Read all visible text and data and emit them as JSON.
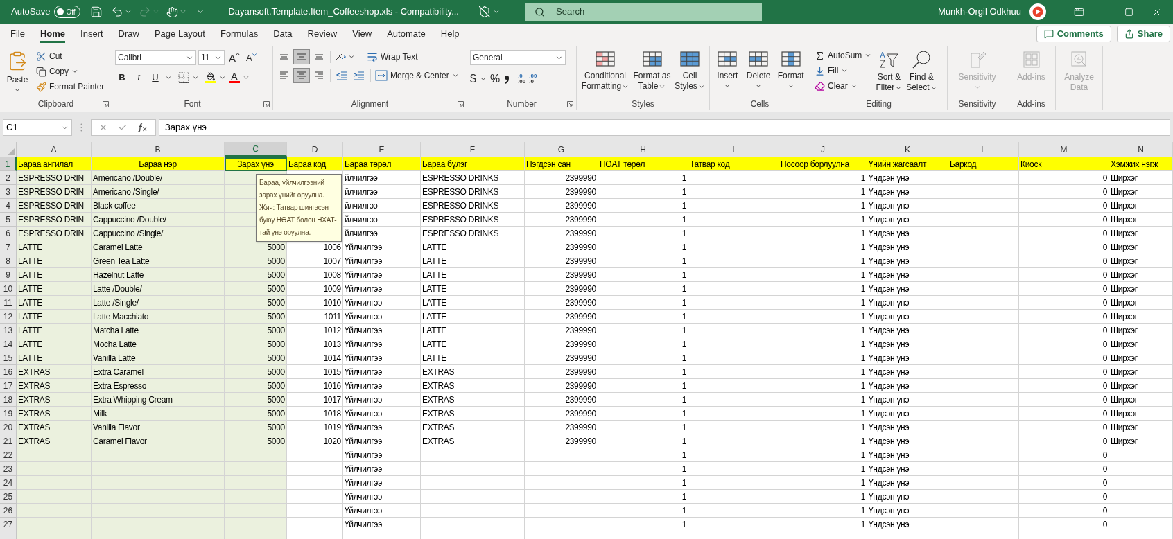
{
  "title_bar": {
    "autosave": {
      "label": "AutoSave",
      "state_text": "Off",
      "on": false
    },
    "redo_enabled": false,
    "file_name": "Dayansoft.Template.Item_Coffeeshop.xls - Compatibility...",
    "search": {
      "placeholder": "Search"
    },
    "user": "Munkh-Orgil Odkhuu"
  },
  "menu_tabs": [
    {
      "label": "File",
      "selected": false
    },
    {
      "label": "Home",
      "selected": true
    },
    {
      "label": "Insert",
      "selected": false
    },
    {
      "label": "Draw",
      "selected": false
    },
    {
      "label": "Page Layout",
      "selected": false
    },
    {
      "label": "Formulas",
      "selected": false
    },
    {
      "label": "Data",
      "selected": false
    },
    {
      "label": "Review",
      "selected": false
    },
    {
      "label": "View",
      "selected": false
    },
    {
      "label": "Automate",
      "selected": false
    },
    {
      "label": "Help",
      "selected": false
    }
  ],
  "actions": [
    {
      "label": "Comments"
    },
    {
      "label": "Share"
    }
  ],
  "ribbon": {
    "groups": [
      {
        "label": "Clipboard",
        "launcher": true,
        "disabled": false,
        "items": [
          {
            "lines": [
              "Paste"
            ]
          },
          {
            "lines": [
              "Cut"
            ]
          },
          {
            "lines": [
              "Copy"
            ]
          },
          {
            "lines": [
              "Format Painter"
            ]
          }
        ]
      },
      {
        "label": "Font",
        "launcher": true,
        "disabled": false,
        "font": "Calibri",
        "size": "11",
        "grow": "A",
        "shrink": "A",
        "bold": "B",
        "italic": "I",
        "underline": "U",
        "font_color": "A"
      },
      {
        "label": "Alignment",
        "launcher": true,
        "disabled": false,
        "vertical": [
          {
            "selected": false
          },
          {
            "selected": true
          },
          {
            "selected": false
          }
        ],
        "horizontal": [
          {
            "selected": false
          },
          {
            "selected": true
          },
          {
            "selected": false
          }
        ],
        "items": [
          {
            "lines": [
              "Wrap Text"
            ]
          },
          {
            "lines": [
              "Merge & Center"
            ]
          }
        ]
      },
      {
        "label": "Number",
        "launcher": true,
        "disabled": false,
        "format": "General",
        "currency": "$",
        "percent": "%",
        "increase_decimal": [
          ".0",
          ".00"
        ],
        "decrease_decimal": [
          ".00",
          ".0"
        ]
      },
      {
        "label": "Styles",
        "launcher": false,
        "disabled": false,
        "items": [
          {
            "lines": [
              "Conditional",
              "Formatting"
            ]
          },
          {
            "lines": [
              "Format as",
              "Table"
            ]
          },
          {
            "lines": [
              "Cell",
              "Styles"
            ]
          }
        ]
      },
      {
        "label": "Cells",
        "launcher": false,
        "disabled": false,
        "items": [
          {
            "lines": [
              "Insert"
            ]
          },
          {
            "lines": [
              "Delete"
            ]
          },
          {
            "lines": [
              "Format"
            ]
          }
        ]
      },
      {
        "label": "Editing",
        "launcher": false,
        "disabled": false,
        "items": [
          {
            "lines": [
              "AutoSum"
            ]
          },
          {
            "lines": [
              "Fill"
            ]
          },
          {
            "lines": [
              "Clear"
            ]
          },
          {
            "lines": [
              "Sort &",
              "Filter"
            ]
          },
          {
            "lines": [
              "Find &",
              "Select"
            ]
          }
        ]
      },
      {
        "label": "Sensitivity",
        "launcher": false,
        "disabled": true,
        "items": [
          {
            "lines": [
              "Sensitivity"
            ]
          }
        ]
      },
      {
        "label": "Add-ins",
        "launcher": false,
        "disabled": true,
        "items": [
          {
            "lines": [
              "Add-ins"
            ]
          }
        ]
      },
      {
        "launcher": false,
        "disabled": true,
        "items": [
          {
            "lines": [
              "Analyze",
              "Data"
            ]
          }
        ]
      }
    ]
  },
  "formula_bar": {
    "name_box": "C1",
    "formula": "Зарах үнэ"
  },
  "sheet": {
    "input_message": "Бараа, үйлчилгээний зарах үнийг оруулна. Жич: Татвар шингэсэн буюу НӨАТ болон НХАТ-тай үнэ оруулна.",
    "columns": [
      {
        "letter": "A",
        "numeric": false,
        "shaded": true,
        "centered": false,
        "selected": false
      },
      {
        "letter": "B",
        "numeric": false,
        "shaded": true,
        "centered": true,
        "selected": false
      },
      {
        "letter": "C",
        "numeric": true,
        "shaded": true,
        "centered": true,
        "selected": true
      },
      {
        "letter": "D",
        "numeric": true,
        "shaded": false,
        "centered": false,
        "selected": false
      },
      {
        "letter": "E",
        "numeric": false,
        "shaded": false,
        "centered": false,
        "selected": false
      },
      {
        "letter": "F",
        "numeric": false,
        "shaded": false,
        "centered": false,
        "selected": false
      },
      {
        "letter": "G",
        "numeric": true,
        "shaded": false,
        "centered": false,
        "selected": false
      },
      {
        "letter": "H",
        "numeric": true,
        "shaded": false,
        "centered": false,
        "selected": false
      },
      {
        "letter": "I",
        "numeric": false,
        "shaded": false,
        "centered": false,
        "selected": false
      },
      {
        "letter": "J",
        "numeric": true,
        "shaded": false,
        "centered": false,
        "selected": false
      },
      {
        "letter": "K",
        "numeric": false,
        "shaded": false,
        "centered": false,
        "selected": false
      },
      {
        "letter": "L",
        "numeric": false,
        "shaded": false,
        "centered": false,
        "selected": false
      },
      {
        "letter": "M",
        "numeric": true,
        "shaded": false,
        "centered": false,
        "selected": false
      },
      {
        "letter": "N",
        "numeric": false,
        "shaded": false,
        "centered": false,
        "selected": false
      }
    ],
    "rows": [
      {
        "number": "1",
        "kind": "header",
        "selected": true,
        "cells": [
          "Бараа ангилал",
          "Бараа нэр",
          "Зарах үнэ",
          "Бараа код",
          "Бараа төрөл",
          "Бараа бүлэг",
          "Нэгдсэн сан",
          "НӨАТ төрөл",
          "Татвар код",
          "Посоор борлуулна",
          "Үнийн жагсаалт",
          "Баркод",
          "Киоск",
          "Хэмжих нэгж"
        ]
      },
      {
        "number": "2",
        "kind": "data",
        "selected": false,
        "cells": [
          "ESPRESSO DRIN",
          "Americano /Double/",
          null,
          null,
          "йлчилгээ",
          "ESPRESSO DRINKS",
          "2399990",
          "1",
          null,
          "1",
          "Үндсэн үнэ",
          null,
          "0",
          "Ширхэг"
        ]
      },
      {
        "number": "3",
        "kind": "data",
        "selected": false,
        "cells": [
          "ESPRESSO DRIN",
          "Americano /Single/",
          null,
          null,
          "йлчилгээ",
          "ESPRESSO DRINKS",
          "2399990",
          "1",
          null,
          "1",
          "Үндсэн үнэ",
          null,
          "0",
          "Ширхэг"
        ]
      },
      {
        "number": "4",
        "kind": "data",
        "selected": false,
        "cells": [
          "ESPRESSO DRIN",
          "Black coffee",
          null,
          null,
          "йлчилгээ",
          "ESPRESSO DRINKS",
          "2399990",
          "1",
          null,
          "1",
          "Үндсэн үнэ",
          null,
          "0",
          "Ширхэг"
        ]
      },
      {
        "number": "5",
        "kind": "data",
        "selected": false,
        "cells": [
          "ESPRESSO DRIN",
          "Cappuccino /Double/",
          null,
          null,
          "йлчилгээ",
          "ESPRESSO DRINKS",
          "2399990",
          "1",
          null,
          "1",
          "Үндсэн үнэ",
          null,
          "0",
          "Ширхэг"
        ]
      },
      {
        "number": "6",
        "kind": "data",
        "selected": false,
        "cells": [
          "ESPRESSO DRIN",
          "Cappuccino /Single/",
          null,
          null,
          "йлчилгээ",
          "ESPRESSO DRINKS",
          "2399990",
          "1",
          null,
          "1",
          "Үндсэн үнэ",
          null,
          "0",
          "Ширхэг"
        ]
      },
      {
        "number": "7",
        "kind": "data",
        "selected": false,
        "cells": [
          "LATTE",
          "Caramel Latte",
          "5000",
          "1006",
          "Үйлчилгээ",
          "LATTE",
          "2399990",
          "1",
          null,
          "1",
          "Үндсэн үнэ",
          null,
          "0",
          "Ширхэг"
        ]
      },
      {
        "number": "8",
        "kind": "data",
        "selected": false,
        "cells": [
          "LATTE",
          "Green Tea Latte",
          "5000",
          "1007",
          "Үйлчилгээ",
          "LATTE",
          "2399990",
          "1",
          null,
          "1",
          "Үндсэн үнэ",
          null,
          "0",
          "Ширхэг"
        ]
      },
      {
        "number": "9",
        "kind": "data",
        "selected": false,
        "cells": [
          "LATTE",
          "Hazelnut Latte",
          "5000",
          "1008",
          "Үйлчилгээ",
          "LATTE",
          "2399990",
          "1",
          null,
          "1",
          "Үндсэн үнэ",
          null,
          "0",
          "Ширхэг"
        ]
      },
      {
        "number": "10",
        "kind": "data",
        "selected": false,
        "cells": [
          "LATTE",
          "Latte /Double/",
          "5000",
          "1009",
          "Үйлчилгээ",
          "LATTE",
          "2399990",
          "1",
          null,
          "1",
          "Үндсэн үнэ",
          null,
          "0",
          "Ширхэг"
        ]
      },
      {
        "number": "11",
        "kind": "data",
        "selected": false,
        "cells": [
          "LATTE",
          "Latte /Single/",
          "5000",
          "1010",
          "Үйлчилгээ",
          "LATTE",
          "2399990",
          "1",
          null,
          "1",
          "Үндсэн үнэ",
          null,
          "0",
          "Ширхэг"
        ]
      },
      {
        "number": "12",
        "kind": "data",
        "selected": false,
        "cells": [
          "LATTE",
          "Latte Macchiato",
          "5000",
          "1011",
          "Үйлчилгээ",
          "LATTE",
          "2399990",
          "1",
          null,
          "1",
          "Үндсэн үнэ",
          null,
          "0",
          "Ширхэг"
        ]
      },
      {
        "number": "13",
        "kind": "data",
        "selected": false,
        "cells": [
          "LATTE",
          "Matcha Latte",
          "5000",
          "1012",
          "Үйлчилгээ",
          "LATTE",
          "2399990",
          "1",
          null,
          "1",
          "Үндсэн үнэ",
          null,
          "0",
          "Ширхэг"
        ]
      },
      {
        "number": "14",
        "kind": "data",
        "selected": false,
        "cells": [
          "LATTE",
          "Mocha Latte",
          "5000",
          "1013",
          "Үйлчилгээ",
          "LATTE",
          "2399990",
          "1",
          null,
          "1",
          "Үндсэн үнэ",
          null,
          "0",
          "Ширхэг"
        ]
      },
      {
        "number": "15",
        "kind": "data",
        "selected": false,
        "cells": [
          "LATTE",
          "Vanilla Latte",
          "5000",
          "1014",
          "Үйлчилгээ",
          "LATTE",
          "2399990",
          "1",
          null,
          "1",
          "Үндсэн үнэ",
          null,
          "0",
          "Ширхэг"
        ]
      },
      {
        "number": "16",
        "kind": "data",
        "selected": false,
        "cells": [
          "EXTRAS",
          "Extra Caramel",
          "5000",
          "1015",
          "Үйлчилгээ",
          "EXTRAS",
          "2399990",
          "1",
          null,
          "1",
          "Үндсэн үнэ",
          null,
          "0",
          "Ширхэг"
        ]
      },
      {
        "number": "17",
        "kind": "data",
        "selected": false,
        "cells": [
          "EXTRAS",
          "Extra Espresso",
          "5000",
          "1016",
          "Үйлчилгээ",
          "EXTRAS",
          "2399990",
          "1",
          null,
          "1",
          "Үндсэн үнэ",
          null,
          "0",
          "Ширхэг"
        ]
      },
      {
        "number": "18",
        "kind": "data",
        "selected": false,
        "cells": [
          "EXTRAS",
          "Extra Whipping Cream",
          "5000",
          "1017",
          "Үйлчилгээ",
          "EXTRAS",
          "2399990",
          "1",
          null,
          "1",
          "Үндсэн үнэ",
          null,
          "0",
          "Ширхэг"
        ]
      },
      {
        "number": "19",
        "kind": "data",
        "selected": false,
        "cells": [
          "EXTRAS",
          "Milk",
          "5000",
          "1018",
          "Үйлчилгээ",
          "EXTRAS",
          "2399990",
          "1",
          null,
          "1",
          "Үндсэн үнэ",
          null,
          "0",
          "Ширхэг"
        ]
      },
      {
        "number": "20",
        "kind": "data",
        "selected": false,
        "cells": [
          "EXTRAS",
          "Vanilla Flavor",
          "5000",
          "1019",
          "Үйлчилгээ",
          "EXTRAS",
          "2399990",
          "1",
          null,
          "1",
          "Үндсэн үнэ",
          null,
          "0",
          "Ширхэг"
        ]
      },
      {
        "number": "21",
        "kind": "data",
        "selected": false,
        "cells": [
          "EXTRAS",
          "Caramel Flavor",
          "5000",
          "1020",
          "Үйлчилгээ",
          "EXTRAS",
          "2399990",
          "1",
          null,
          "1",
          "Үндсэн үнэ",
          null,
          "0",
          "Ширхэг"
        ]
      },
      {
        "number": "22",
        "kind": "data",
        "selected": false,
        "cells": [
          null,
          null,
          null,
          null,
          "Үйлчилгээ",
          null,
          null,
          "1",
          null,
          "1",
          "Үндсэн үнэ",
          null,
          "0",
          null
        ]
      },
      {
        "number": "23",
        "kind": "data",
        "selected": false,
        "cells": [
          null,
          null,
          null,
          null,
          "Үйлчилгээ",
          null,
          null,
          "1",
          null,
          "1",
          "Үндсэн үнэ",
          null,
          "0",
          null
        ]
      },
      {
        "number": "24",
        "kind": "data",
        "selected": false,
        "cells": [
          null,
          null,
          null,
          null,
          "Үйлчилгээ",
          null,
          null,
          "1",
          null,
          "1",
          "Үндсэн үнэ",
          null,
          "0",
          null
        ]
      },
      {
        "number": "25",
        "kind": "data",
        "selected": false,
        "cells": [
          null,
          null,
          null,
          null,
          "Үйлчилгээ",
          null,
          null,
          "1",
          null,
          "1",
          "Үндсэн үнэ",
          null,
          "0",
          null
        ]
      },
      {
        "number": "26",
        "kind": "data",
        "selected": false,
        "cells": [
          null,
          null,
          null,
          null,
          "Үйлчилгээ",
          null,
          null,
          "1",
          null,
          "1",
          "Үндсэн үнэ",
          null,
          "0",
          null
        ]
      },
      {
        "number": "27",
        "kind": "data",
        "selected": false,
        "cells": [
          null,
          null,
          null,
          null,
          "Үйлчилгээ",
          null,
          null,
          "1",
          null,
          "1",
          "Үндсэн үнэ",
          null,
          "0",
          null
        ]
      }
    ]
  }
}
